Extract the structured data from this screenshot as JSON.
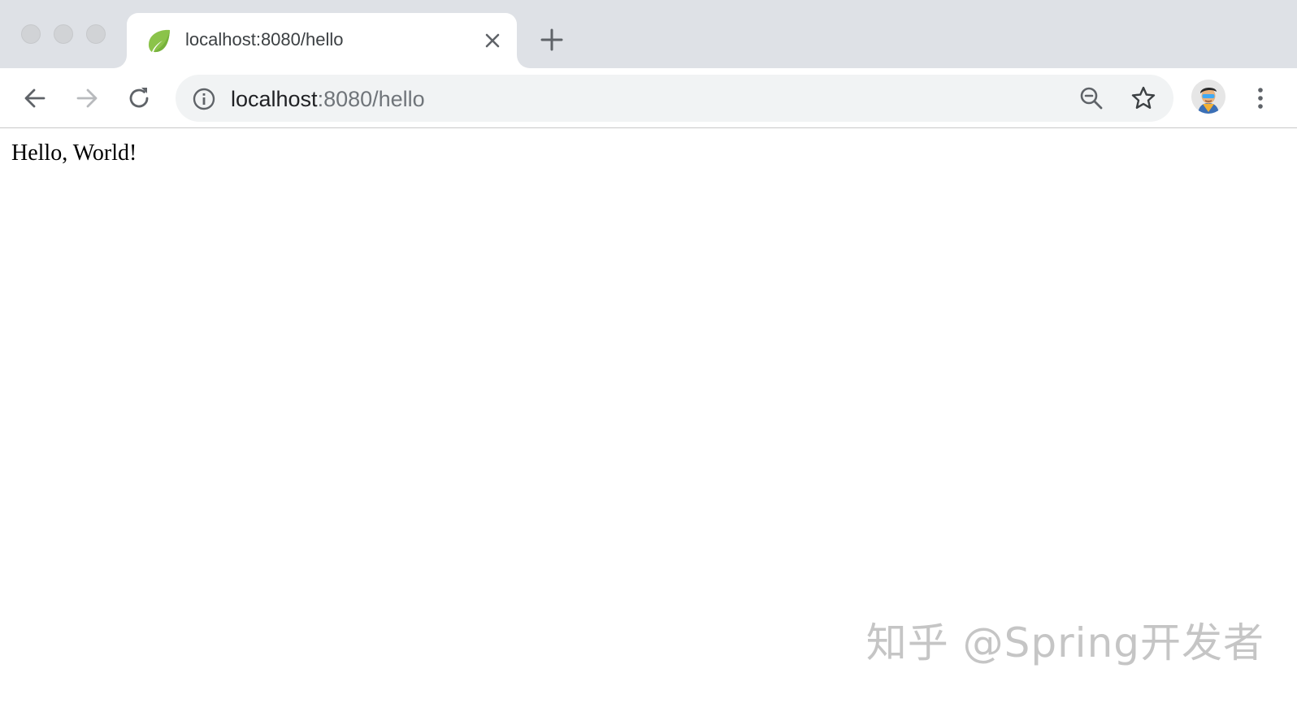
{
  "tab": {
    "title": "localhost:8080/hello",
    "favicon": "spring-leaf-icon"
  },
  "omnibox": {
    "url_host": "localhost",
    "url_rest": ":8080/hello"
  },
  "page": {
    "body_text": "Hello, World!"
  },
  "watermark": {
    "text": "知乎 @Spring开发者"
  },
  "colors": {
    "tabstrip": "#dee1e6",
    "omnibox": "#f1f3f4",
    "leaf": "#8bc34a"
  }
}
